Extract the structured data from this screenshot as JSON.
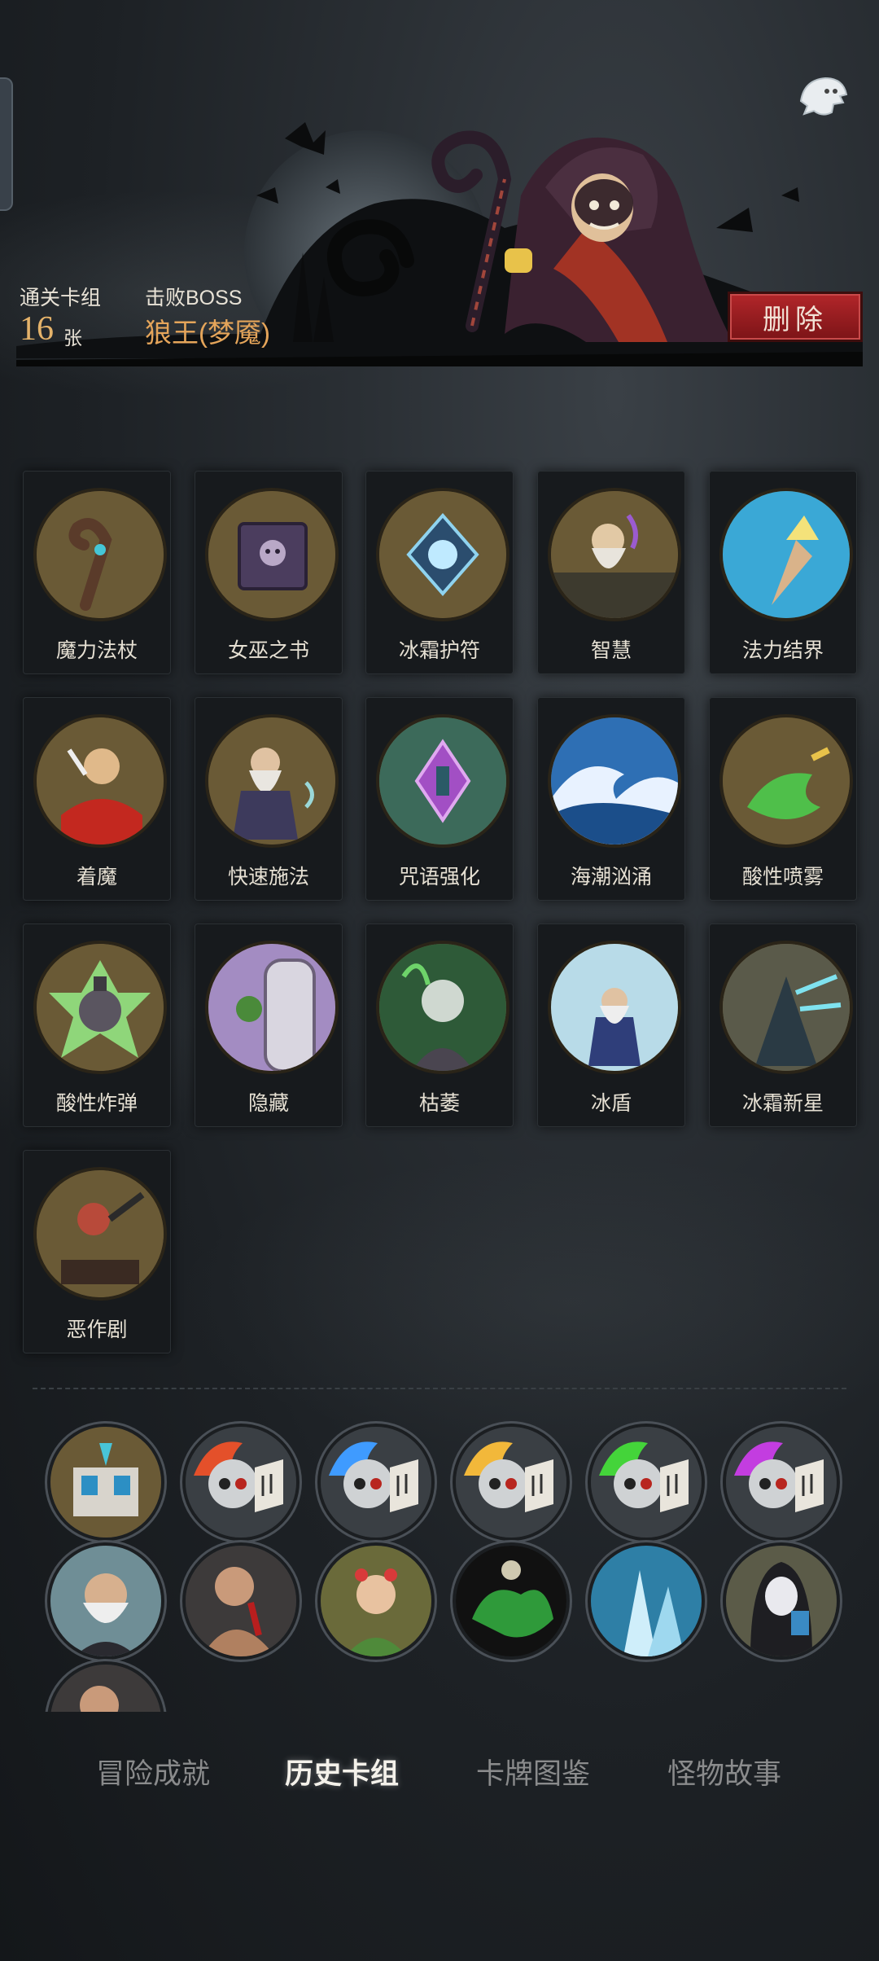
{
  "header": {
    "deck_label": "通关卡组",
    "deck_count": "16",
    "deck_unit": "张",
    "boss_label": "击败BOSS",
    "boss_name": "狼王(梦魇)",
    "delete_label": "删除"
  },
  "cards": [
    {
      "label": "魔力法杖",
      "icon": "staff-icon"
    },
    {
      "label": "女巫之书",
      "icon": "witch-book-icon"
    },
    {
      "label": "冰霜护符",
      "icon": "frost-amulet-icon"
    },
    {
      "label": "智慧",
      "icon": "wisdom-sage-icon"
    },
    {
      "label": "法力结界",
      "icon": "mana-barrier-icon"
    },
    {
      "label": "着魔",
      "icon": "possessed-icon"
    },
    {
      "label": "快速施法",
      "icon": "quick-cast-icon"
    },
    {
      "label": "咒语强化",
      "icon": "spell-boost-icon"
    },
    {
      "label": "海潮汹涌",
      "icon": "tidal-wave-icon"
    },
    {
      "label": "酸性喷雾",
      "icon": "acid-spray-icon"
    },
    {
      "label": "酸性炸弹",
      "icon": "acid-bomb-icon"
    },
    {
      "label": "隐藏",
      "icon": "hide-door-icon"
    },
    {
      "label": "枯萎",
      "icon": "wither-icon"
    },
    {
      "label": "冰盾",
      "icon": "ice-shield-icon"
    },
    {
      "label": "冰霜新星",
      "icon": "frost-nova-icon"
    },
    {
      "label": "恶作剧",
      "icon": "prank-icon"
    }
  ],
  "relics": [
    {
      "icon": "spellbook-relic-icon"
    },
    {
      "icon": "red-flame-skull-icon"
    },
    {
      "icon": "blue-flame-skull-icon"
    },
    {
      "icon": "yellow-flame-skull-icon"
    },
    {
      "icon": "green-flame-skull-icon"
    },
    {
      "icon": "purple-flame-skull-icon"
    },
    {
      "icon": "old-man-relic-icon"
    },
    {
      "icon": "bloody-brute-icon"
    },
    {
      "icon": "flower-dryad-icon"
    },
    {
      "icon": "green-ghost-icon"
    },
    {
      "icon": "ice-crystal-icon"
    },
    {
      "icon": "hooded-masked-icon"
    },
    {
      "icon": "bloody-brute-icon"
    }
  ],
  "tabs": [
    {
      "label": "冒险成就",
      "active": false
    },
    {
      "label": "历史卡组",
      "active": true
    },
    {
      "label": "卡牌图鉴",
      "active": false
    },
    {
      "label": "怪物故事",
      "active": false
    }
  ],
  "colors": {
    "accent_gold": "#e5b36a",
    "delete_red": "#a01e22",
    "card_bg": "#171a1d"
  }
}
